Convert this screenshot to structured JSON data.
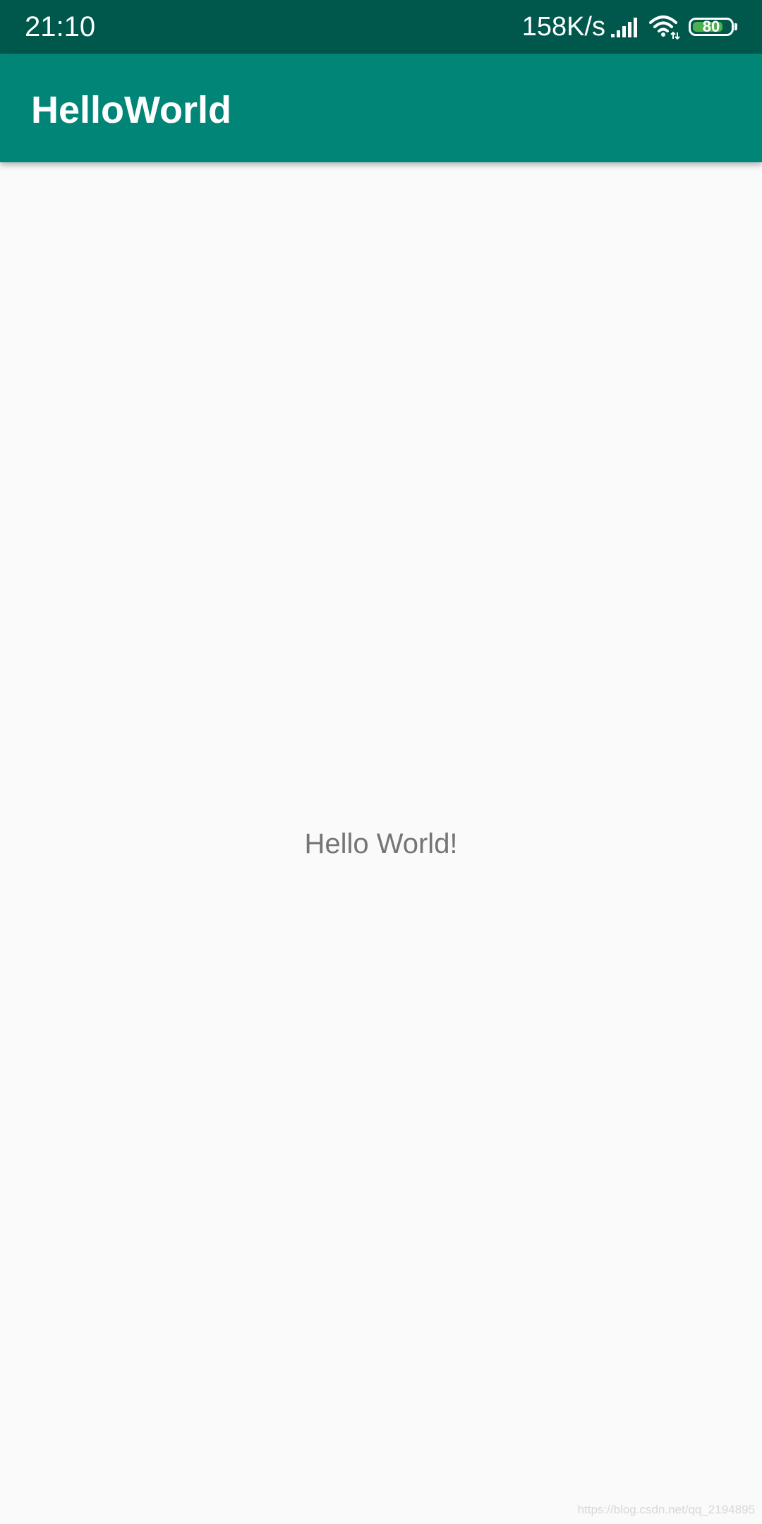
{
  "status_bar": {
    "time": "21:10",
    "net_speed": "158K/s",
    "battery_level": "80",
    "battery_percent": 80,
    "background": "#00574b",
    "battery_fill_color": "#4caf50",
    "icons": [
      "signal-icon",
      "wifi-icon",
      "battery-icon"
    ]
  },
  "app_bar": {
    "title": "HelloWorld",
    "background": "#008577"
  },
  "content": {
    "message": "Hello World!",
    "text_color": "#757575",
    "background": "#fafafa"
  },
  "watermark": {
    "text": "https://blog.csdn.net/qq_2194895"
  }
}
